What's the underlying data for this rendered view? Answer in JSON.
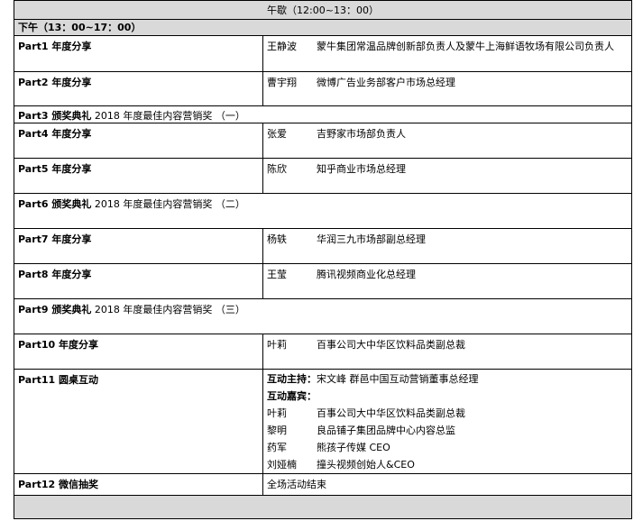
{
  "noon_break": "午歇（12:00~13：00）",
  "afternoon_header": "下午（13：00~17：00）",
  "rows": [
    {
      "part": "Part1 年度分享",
      "name": "王静波",
      "title": "蒙牛集团常温品牌创新部负责人及蒙牛上海鲜语牧场有限公司负责人"
    },
    {
      "part": "Part2 年度分享",
      "name": "曹宇翔",
      "title": "微博广告业务部客户市场总经理"
    },
    {
      "part": "Part3 颁奖典礼",
      "detail": "2018 年度最佳内容营销奖 （一）"
    },
    {
      "part": "Part4 年度分享",
      "name": "张爱",
      "title": "吉野家市场部负责人"
    },
    {
      "part": "Part5 年度分享",
      "name": "陈欣",
      "title": "知乎商业市场总经理"
    },
    {
      "part": "Part6 颁奖典礼",
      "detail": "2018 年度最佳内容营销奖 （二）"
    },
    {
      "part": "Part7 年度分享",
      "name": "杨轶",
      "title": "华润三九市场部副总经理"
    },
    {
      "part": "Part8 年度分享",
      "name": "王莹",
      "title": "腾讯视频商业化总经理"
    },
    {
      "part": "Part9 颁奖典礼",
      "detail": "2018 年度最佳内容营销奖 （三）"
    },
    {
      "part": "Part10 年度分享",
      "name": "叶莉",
      "title": "百事公司大中华区饮料品类副总裁"
    }
  ],
  "part11": {
    "part": "Part11 圆桌互动",
    "host_label": "互动主持：",
    "host": "宋文峰 群邑中国互动营销董事总经理",
    "guests_label": "互动嘉宾：",
    "guests": [
      {
        "name": "叶莉",
        "title": "百事公司大中华区饮料品类副总裁"
      },
      {
        "name": "黎明",
        "title": "良品铺子集团品牌中心内容总监"
      },
      {
        "name": "药军",
        "title": "熊孩子传媒 CEO"
      },
      {
        "name": "刘娅楠",
        "title": "撞头视频创始人&CEO"
      }
    ]
  },
  "part12": {
    "part": "Part12 微信抽奖",
    "detail": "全场活动结束"
  }
}
